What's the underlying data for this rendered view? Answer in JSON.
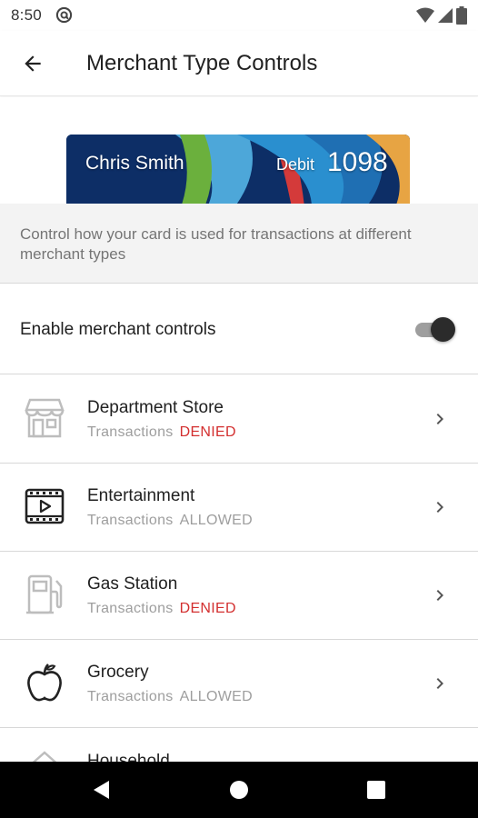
{
  "status_bar": {
    "time": "8:50"
  },
  "app_bar": {
    "title": "Merchant Type Controls"
  },
  "card": {
    "holder_name": "Chris Smith",
    "card_type": "Debit",
    "last_digits": "1098"
  },
  "description": "Control how your card is used for transactions at different merchant types",
  "merchant_controls": {
    "label": "Enable merchant controls",
    "enabled": true
  },
  "merchants": [
    {
      "name": "Department Store",
      "prefix": "Transactions",
      "status": "DENIED",
      "icon": "storefront-icon"
    },
    {
      "name": "Entertainment",
      "prefix": "Transactions",
      "status": "ALLOWED",
      "icon": "film-icon"
    },
    {
      "name": "Gas Station",
      "prefix": "Transactions",
      "status": "DENIED",
      "icon": "gas-pump-icon"
    },
    {
      "name": "Grocery",
      "prefix": "Transactions",
      "status": "ALLOWED",
      "icon": "apple-icon"
    },
    {
      "name": "Household",
      "icon": "house-icon"
    }
  ],
  "colors": {
    "denied": "#d32f2f",
    "allowed": "#9e9e9e",
    "card_background": "#0d2e66"
  }
}
